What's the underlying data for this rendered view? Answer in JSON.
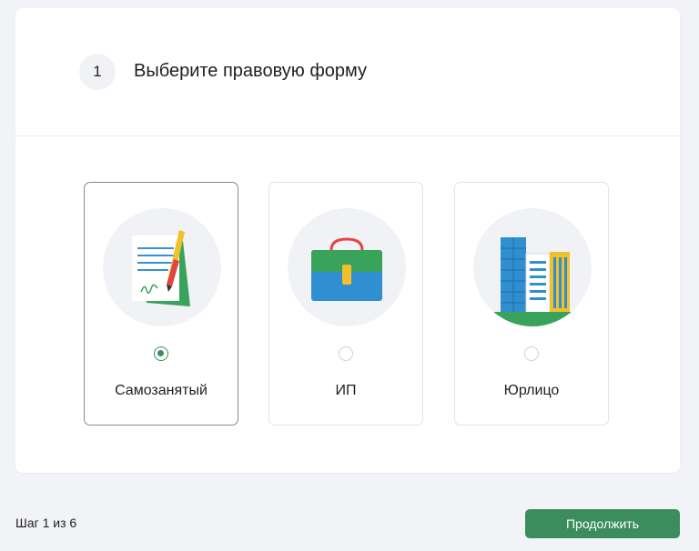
{
  "step": {
    "number": "1",
    "title": "Выберите правовую форму"
  },
  "options": [
    {
      "label": "Самозанятый",
      "icon": "signed-document-icon",
      "selected": true
    },
    {
      "label": "ИП",
      "icon": "briefcase-icon",
      "selected": false
    },
    {
      "label": "Юрлицо",
      "icon": "office-buildings-icon",
      "selected": false
    }
  ],
  "footer": {
    "progress": "Шаг 1 из 6",
    "continue_label": "Продолжить"
  },
  "colors": {
    "accent": "#3b8d5d",
    "background": "#f2f3f7",
    "card": "#ffffff"
  }
}
